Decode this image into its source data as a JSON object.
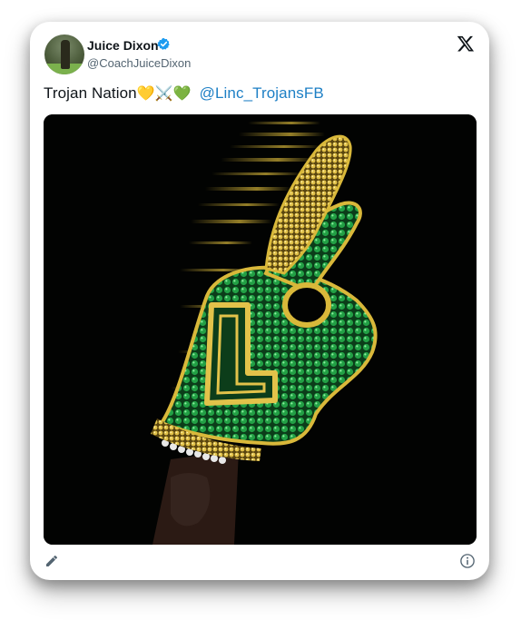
{
  "tweet": {
    "author_name": "Juice Dixon",
    "author_handle": "@CoachJuiceDixon",
    "text": "Trojan Nation",
    "emojis": "💛⚔️💚",
    "mention": "@Linc_TrojansFB"
  },
  "icons": {
    "verified": "verified-badge-icon",
    "brand": "x-logo-icon",
    "edit": "pencil-icon",
    "info": "info-icon"
  },
  "colors": {
    "verified": "#1d9bf0",
    "mention": "#1d7fc5",
    "glove_green": "#1f8a3a",
    "glove_gold": "#d9b83a"
  }
}
